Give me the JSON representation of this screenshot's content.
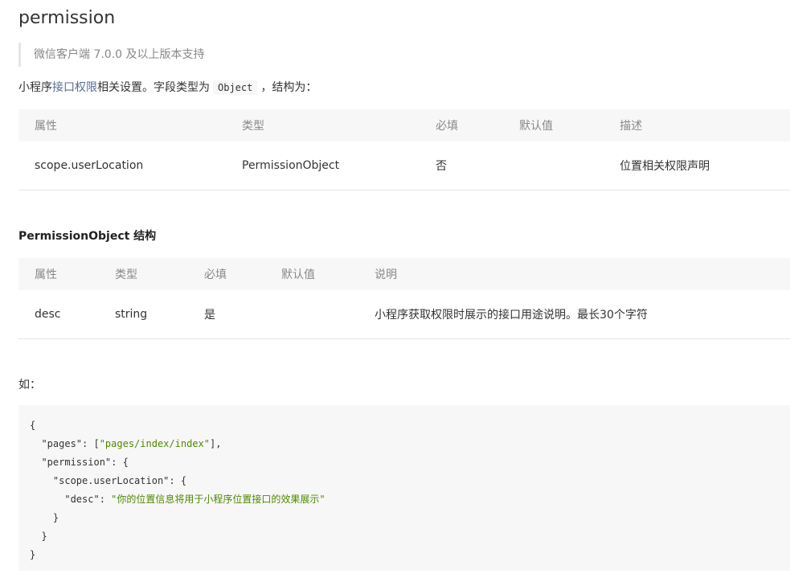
{
  "title": "permission",
  "note": "微信客户端 7.0.0 及以上版本支持",
  "intro": {
    "prefix": "小程序",
    "link": "接口权限",
    "middle": "相关设置。字段类型为",
    "code": "Object",
    "suffix": "，结构为："
  },
  "table1": {
    "headers": [
      "属性",
      "类型",
      "必填",
      "默认值",
      "描述"
    ],
    "rows": [
      [
        "scope.userLocation",
        "PermissionObject",
        "否",
        "",
        "位置相关权限声明"
      ]
    ]
  },
  "subhead": "PermissionObject 结构",
  "table2": {
    "headers": [
      "属性",
      "类型",
      "必填",
      "默认值",
      "说明"
    ],
    "rows": [
      [
        "desc",
        "string",
        "是",
        "",
        "小程序获取权限时展示的接口用途说明。最长30个字符"
      ]
    ]
  },
  "example_label": "如：",
  "code": {
    "l1": "{",
    "l2_key": "  \"pages\": [",
    "l2_val": "\"pages/index/index\"",
    "l2_end": "],",
    "l3": "  \"permission\": {",
    "l4": "    \"scope.userLocation\": {",
    "l5_key": "      \"desc\": ",
    "l5_val": "\"你的位置信息将用于小程序位置接口的效果展示\"",
    "l6": "    }",
    "l7": "  }",
    "l8": "}"
  }
}
